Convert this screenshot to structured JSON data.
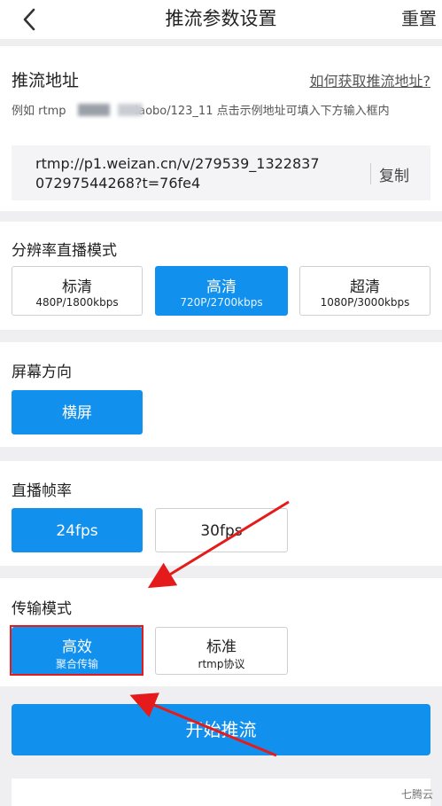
{
  "header": {
    "title": "推流参数设置",
    "reset_label": "重置",
    "back_icon": "chevron-left-icon"
  },
  "push": {
    "title": "推流地址",
    "help_link": "如何获取推流地址?",
    "example_prefix": "例如 rtmp",
    "example_suffix": "laobo/123_11 点击示例地址可填入下方输入框内",
    "url": "rtmp://p1.weizan.cn/v/279539_132283707297544268?t=76fe4",
    "copy_label": "复制"
  },
  "resolution": {
    "label": "分辨率直播模式",
    "options": [
      {
        "main": "标清",
        "sub": "480P/1800kbps",
        "selected": false
      },
      {
        "main": "高清",
        "sub": "720P/2700kbps",
        "selected": true
      },
      {
        "main": "超清",
        "sub": "1080P/3000kbps",
        "selected": false
      }
    ]
  },
  "orientation": {
    "label": "屏幕方向",
    "option": "横屏"
  },
  "framerate": {
    "label": "直播帧率",
    "options": [
      {
        "main": "24fps",
        "selected": true
      },
      {
        "main": "30fps",
        "selected": false
      }
    ]
  },
  "transfer": {
    "label": "传输模式",
    "options": [
      {
        "main": "高效",
        "sub": "聚合传输",
        "selected": true
      },
      {
        "main": "标准",
        "sub": "rtmp协议",
        "selected": false
      }
    ]
  },
  "start_label": "开始推流",
  "watermark": "七腾云",
  "colors": {
    "accent": "#1290ee",
    "annotation": "#e51b1b"
  }
}
